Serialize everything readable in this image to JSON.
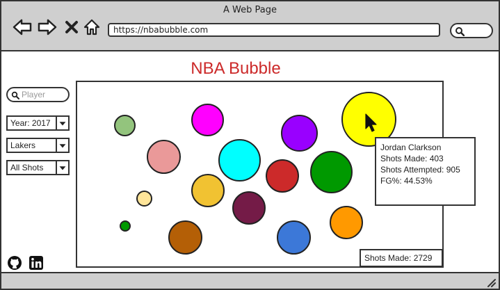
{
  "window": {
    "title": "A Web Page"
  },
  "browser": {
    "url": "https://nbabubble.com",
    "nav_icons": [
      "back-arrow-icon",
      "forward-arrow-icon",
      "close-x-icon",
      "home-icon"
    ],
    "search_icon": "search-icon"
  },
  "page": {
    "title": "NBA Bubble",
    "title_color": "#cc2a2a"
  },
  "sidebar": {
    "player_search": {
      "placeholder": "Player",
      "value": ""
    },
    "year_select": {
      "value": "Year: 2017"
    },
    "team_select": {
      "value": "Lakers"
    },
    "shot_select": {
      "value": "All Shots"
    }
  },
  "bubbles": [
    {
      "color": "#93c47d"
    },
    {
      "color": "#ff00ff"
    },
    {
      "color": "#9900ff"
    },
    {
      "color": "#ffff00"
    },
    {
      "color": "#ea9999"
    },
    {
      "color": "#00ffff"
    },
    {
      "color": "#cc2a2a"
    },
    {
      "color": "#009900"
    },
    {
      "color": "#f1c232"
    },
    {
      "color": "#741b47"
    },
    {
      "color": "#ffe599"
    },
    {
      "color": "#009900"
    },
    {
      "color": "#b45f06"
    },
    {
      "color": "#3c78d8"
    },
    {
      "color": "#ff9900"
    }
  ],
  "tooltip": {
    "player": "Jordan Clarkson",
    "shots_made": "Shots Made: 403",
    "shots_attempted": "Shots Attempted: 905",
    "fg_pct": "FG%: 44.53%"
  },
  "total": {
    "label": "Shots Made: 2729"
  },
  "social_icons": [
    "github-icon",
    "linkedin-icon"
  ]
}
